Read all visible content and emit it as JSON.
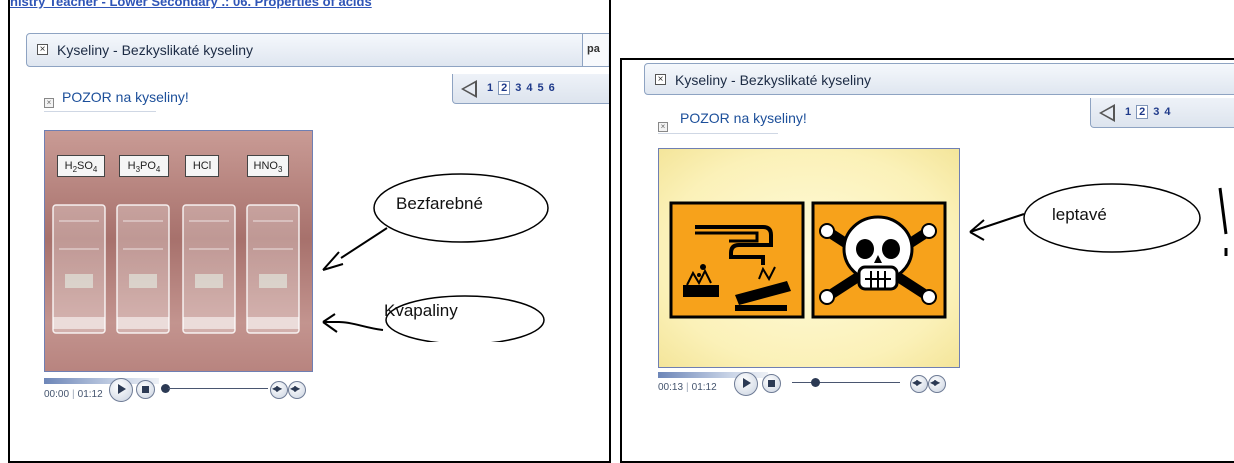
{
  "left_panel": {
    "breadcrumb": "nistry Teacher - Lower Secondary  .: 06. Properties of acids",
    "module_title": "Kyseliny - Bezkyslikaté kyseliny",
    "pagination_stub": "pa",
    "pages": [
      "1",
      "2",
      "3",
      "4",
      "5",
      "6"
    ],
    "current_page": "2",
    "section_title": "POZOR na kyseliny!",
    "chem_labels": [
      {
        "base": "H",
        "sub1": "2",
        "mid": "SO",
        "sub2": "4"
      },
      {
        "base": "H",
        "sub1": "3",
        "mid": "PO",
        "sub2": "4"
      },
      {
        "base": "HCl",
        "sub1": "",
        "mid": "",
        "sub2": ""
      },
      {
        "base": "HNO",
        "sub1": "3",
        "mid": "",
        "sub2": ""
      }
    ],
    "time_current": "00:00",
    "time_total": "01:12",
    "seek_progress": 0.0,
    "annotations": [
      "Bezfarebné",
      "Kvapaliny"
    ]
  },
  "right_panel": {
    "module_title": "Kyseliny - Bezkyslikaté kyseliny",
    "pages": [
      "1",
      "2",
      "3",
      "4"
    ],
    "current_page": "2",
    "section_title": "POZOR na kyseliny!",
    "time_current": "00:13",
    "time_total": "01:12",
    "seek_progress": 0.18,
    "annotation": "leptavé"
  },
  "colors": {
    "hazard_orange": "#f7a21b",
    "link_blue": "#2f55b7",
    "title_blue": "#1c4f9a"
  },
  "icons": [
    "close-box-icon",
    "prev-page-icon",
    "play-icon",
    "stop-icon",
    "volume-icon",
    "corrosive-icon",
    "toxic-skull-icon"
  ]
}
